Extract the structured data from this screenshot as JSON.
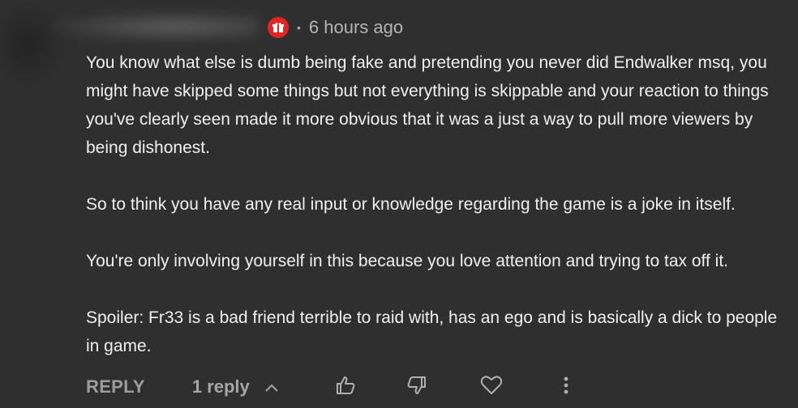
{
  "comment": {
    "timestamp": "6 hours ago",
    "separator": "•",
    "paragraphs": [
      "You know what else is dumb being fake and pretending you never did Endwalker msq, you might have skipped some things but not everything is skippable and your reaction to things you've clearly seen made it more obvious that it was a just a way to pull more viewers by being dishonest.",
      "So to think you have any real input or knowledge regarding the game is a joke in itself.",
      "You're only involving yourself in this because you love attention and trying to tax off it.",
      "Spoiler: Fr33 is a bad friend terrible to raid with, has an ego and is basically a dick to people in game."
    ]
  },
  "actions": {
    "reply_label": "REPLY",
    "replies_label": "1 reply"
  },
  "icons": {
    "badge": "gift-icon",
    "expand": "chevron-up-icon",
    "like": "thumbs-up-icon",
    "dislike": "thumbs-down-icon",
    "heart": "heart-icon",
    "more": "more-vertical-icon"
  },
  "colors": {
    "background": "#2f2f2f",
    "badge": "#e52424",
    "text": "#f0f0f0",
    "muted": "#a6a6a6"
  }
}
